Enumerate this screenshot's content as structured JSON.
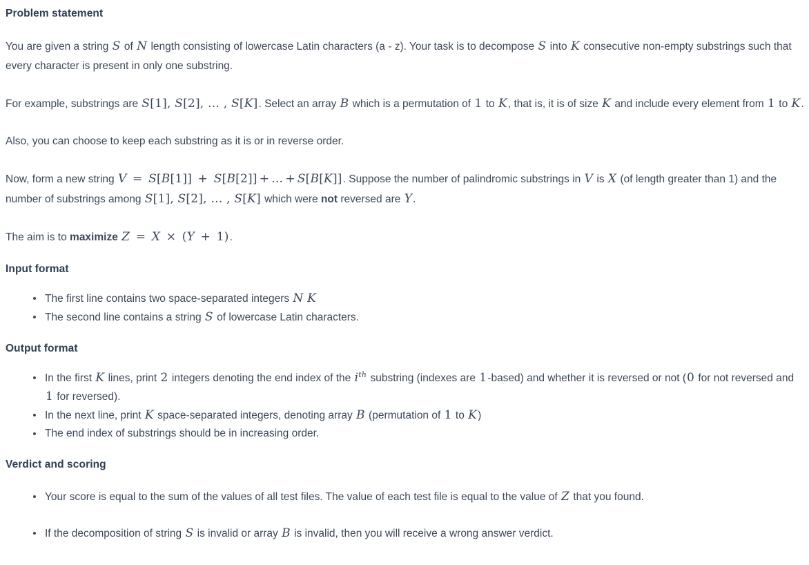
{
  "document": {
    "sections": [
      {
        "id": "problem-statement",
        "heading": "Problem statement",
        "paragraphs": [
          {
            "id": "p1",
            "parts": [
              {
                "t": "text",
                "v": "You are given a string "
              },
              {
                "t": "math",
                "v": "S"
              },
              {
                "t": "text",
                "v": " of "
              },
              {
                "t": "math",
                "v": "N"
              },
              {
                "t": "text",
                "v": " length consisting of lowercase Latin characters (a - z). Your task is to decompose "
              },
              {
                "t": "math",
                "v": "S"
              },
              {
                "t": "text",
                "v": " into "
              },
              {
                "t": "math",
                "v": "K"
              },
              {
                "t": "text",
                "v": " consecutive non-empty substrings such that every character is present in only one substring."
              }
            ]
          },
          {
            "id": "p2",
            "parts": [
              {
                "t": "text",
                "v": "For example, substrings are "
              },
              {
                "t": "math",
                "v": "S[1], S[2], … , S[K]"
              },
              {
                "t": "text",
                "v": ". Select an array "
              },
              {
                "t": "math",
                "v": "B"
              },
              {
                "t": "text",
                "v": " which is a permutation of "
              },
              {
                "t": "math",
                "v": "1"
              },
              {
                "t": "text",
                "v": " to "
              },
              {
                "t": "math",
                "v": "K"
              },
              {
                "t": "text",
                "v": ", that is, it is of size "
              },
              {
                "t": "math",
                "v": "K"
              },
              {
                "t": "text",
                "v": " and include every element from "
              },
              {
                "t": "math",
                "v": "1"
              },
              {
                "t": "text",
                "v": " to "
              },
              {
                "t": "math",
                "v": "K"
              },
              {
                "t": "text",
                "v": "."
              }
            ]
          },
          {
            "id": "p3",
            "parts": [
              {
                "t": "text",
                "v": "Also, you can choose to keep each substring as it is or in reverse order."
              }
            ]
          },
          {
            "id": "p4",
            "parts": [
              {
                "t": "text",
                "v": "Now, form a new string "
              },
              {
                "t": "math",
                "v": "V = S[B[1]] + S[B[2]]+…+S[B[K]]"
              },
              {
                "t": "text",
                "v": ". Suppose the number of palindromic substrings in "
              },
              {
                "t": "math",
                "v": "V"
              },
              {
                "t": "text",
                "v": " is "
              },
              {
                "t": "math",
                "v": "X"
              },
              {
                "t": "text",
                "v": " (of length greater than 1) and the number of substrings among "
              },
              {
                "t": "math",
                "v": "S[1], S[2], … , S[K]"
              },
              {
                "t": "text",
                "v": " which were "
              },
              {
                "t": "bold",
                "v": "not"
              },
              {
                "t": "text",
                "v": " reversed are "
              },
              {
                "t": "math",
                "v": "Y"
              },
              {
                "t": "text",
                "v": "."
              }
            ]
          },
          {
            "id": "p5",
            "parts": [
              {
                "t": "text",
                "v": "The aim is to "
              },
              {
                "t": "bold",
                "v": "maximize"
              },
              {
                "t": "text",
                "v": " "
              },
              {
                "t": "math",
                "v": "Z = X × (Y + 1)"
              },
              {
                "t": "text",
                "v": "."
              }
            ]
          }
        ]
      },
      {
        "id": "input-format",
        "heading": "Input format",
        "bullets": [
          {
            "id": "in-b1",
            "parts": [
              {
                "t": "text",
                "v": "The first line contains two space-separated integers "
              },
              {
                "t": "math",
                "v": "N  K"
              }
            ]
          },
          {
            "id": "in-b2",
            "parts": [
              {
                "t": "text",
                "v": "The second line contains a string "
              },
              {
                "t": "math",
                "v": "S"
              },
              {
                "t": "text",
                "v": " of lowercase Latin characters."
              }
            ]
          }
        ]
      },
      {
        "id": "output-format",
        "heading": "Output format",
        "bullets": [
          {
            "id": "out-b1",
            "parts": [
              {
                "t": "text",
                "v": "In the first "
              },
              {
                "t": "math",
                "v": "K"
              },
              {
                "t": "text",
                "v": " lines, print "
              },
              {
                "t": "math",
                "v": "2"
              },
              {
                "t": "text",
                "v": " integers denoting the end index of the "
              },
              {
                "t": "math",
                "v": "i^{th}"
              },
              {
                "t": "text",
                "v": " substring (indexes are "
              },
              {
                "t": "math",
                "v": "1"
              },
              {
                "t": "text",
                "v": "-based) and whether it is reversed or not ("
              },
              {
                "t": "math",
                "v": "0"
              },
              {
                "t": "text",
                "v": " for not reversed and "
              },
              {
                "t": "math",
                "v": "1"
              },
              {
                "t": "text",
                "v": " for reversed)."
              }
            ]
          },
          {
            "id": "out-b2",
            "parts": [
              {
                "t": "text",
                "v": "In the next line, print "
              },
              {
                "t": "math",
                "v": "K"
              },
              {
                "t": "text",
                "v": " space-separated integers, denoting array "
              },
              {
                "t": "math",
                "v": "B"
              },
              {
                "t": "text",
                "v": " (permutation of "
              },
              {
                "t": "math",
                "v": "1"
              },
              {
                "t": "text",
                "v": " to "
              },
              {
                "t": "math",
                "v": "K"
              },
              {
                "t": "text",
                "v": ")"
              }
            ]
          },
          {
            "id": "out-b3",
            "parts": [
              {
                "t": "text",
                "v": "The end index of substrings should be in increasing order."
              }
            ]
          }
        ]
      },
      {
        "id": "verdict-and-scoring",
        "heading": "Verdict and scoring",
        "bullets": [
          {
            "id": "v-b1",
            "parts": [
              {
                "t": "text",
                "v": "Your score is equal to the sum of the values of all test files. The value of each test file is equal to the value of "
              },
              {
                "t": "math",
                "v": "Z"
              },
              {
                "t": "text",
                "v": " that you found."
              }
            ]
          },
          {
            "id": "v-b2",
            "parts": [
              {
                "t": "text",
                "v": "If the decomposition of string "
              },
              {
                "t": "math",
                "v": "S"
              },
              {
                "t": "text",
                "v": " is invalid or array "
              },
              {
                "t": "math",
                "v": "B"
              },
              {
                "t": "text",
                "v": " is invalid, then you will receive a wrong answer verdict."
              }
            ]
          }
        ]
      }
    ],
    "colors": {
      "heading": "#2c3e50",
      "body": "#3c4858",
      "background": "#ffffff"
    }
  }
}
